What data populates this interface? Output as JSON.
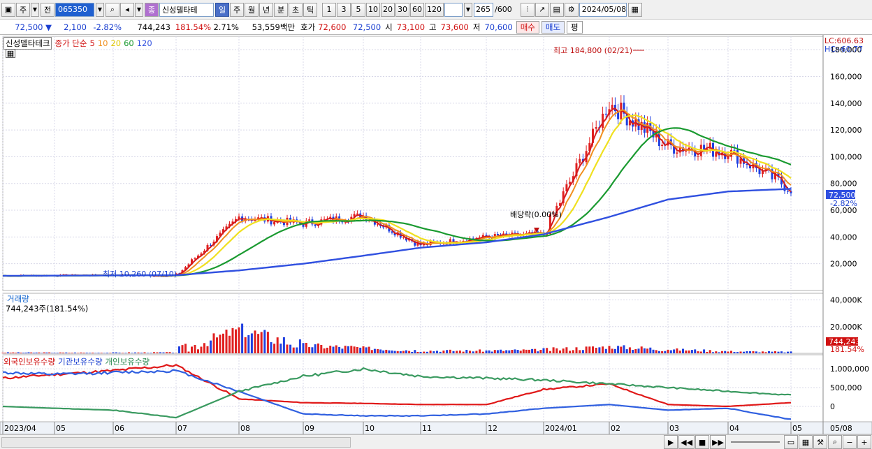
{
  "toolbar": {
    "period_options": [
      "주",
      "전"
    ],
    "code": "065350",
    "stock_name": "신성델타테",
    "intervals": [
      "일",
      "주",
      "월",
      "년",
      "분",
      "초",
      "틱"
    ],
    "active_interval": "일",
    "numbers": [
      "1",
      "3",
      "5",
      "10",
      "20",
      "30",
      "60",
      "120"
    ],
    "count": "265",
    "count_total": "/600",
    "date": "2024/05/08"
  },
  "quote": {
    "price": "72,500",
    "change": "2,100",
    "change_pct": "-2.82%",
    "volume": "744,243",
    "volume_ratio": "181.54%",
    "turnover_pct": "2.71%",
    "amount": "53,559백만",
    "bid_label": "호가",
    "bid": "72,600",
    "ask": "72,500",
    "open_label": "시",
    "open": "73,100",
    "high_label": "고",
    "high": "73,600",
    "low_label": "저",
    "low": "70,600",
    "buy_label": "매수",
    "sell_label": "매도",
    "eval_label": "평"
  },
  "price_panel": {
    "stock_label": "신성델타테크",
    "indicator_label": "종가 단순",
    "ma_labels": [
      "5",
      "10",
      "20",
      "60",
      "120"
    ],
    "lc": "LC:606.63",
    "hc": "HC:-60.77",
    "max_note": "최고 184,800 (02/21)",
    "min_note": "최저 10,260 (07/10)",
    "dividend_note": "배당락(0.00%)",
    "last_price_tag": "72,500",
    "last_pct_tag": "-2.82%",
    "y_ticks": [
      "180,000",
      "160,000",
      "140,000",
      "120,000",
      "100,000",
      "80,000",
      "60,000",
      "40,000",
      "20,000"
    ]
  },
  "volume_panel": {
    "title": "거래량",
    "value_label": "744,243주(181.54%)",
    "tag_value": "744,243",
    "tag_pct": "181.54%",
    "y_ticks": [
      "40,000K",
      "20,000K"
    ]
  },
  "holdings_panel": {
    "series_labels": [
      "외국인보유수량",
      "기관보유수량",
      "개인보유수량"
    ],
    "y_ticks": [
      "1,000,000",
      "500,000",
      "0"
    ]
  },
  "x_axis": [
    "2023/04",
    "05",
    "06",
    "07",
    "08",
    "09",
    "10",
    "11",
    "12",
    "2024/01",
    "02",
    "03",
    "04",
    "05",
    "05/08"
  ],
  "colors": {
    "ma5": "#d41c1c",
    "ma10": "#f09020",
    "ma20": "#f0e020",
    "ma60": "#1a9a30",
    "ma120": "#3050e0",
    "up": "#e02020",
    "down": "#2040e0",
    "foreign": "#e01818",
    "institution": "#3060e0",
    "individual": "#3a9a60"
  },
  "chart_data": {
    "type": "candlestick",
    "x": [
      "2023/04",
      "05",
      "06",
      "07",
      "08",
      "09",
      "10",
      "11",
      "12",
      "2024/01",
      "02",
      "03",
      "04",
      "05"
    ],
    "close": [
      11000,
      11500,
      12000,
      11200,
      52000,
      48000,
      58000,
      36000,
      40000,
      45000,
      135000,
      110000,
      100000,
      72500
    ],
    "ma120": [
      11000,
      11100,
      11300,
      11400,
      15000,
      20000,
      26000,
      32000,
      36000,
      42000,
      55000,
      68000,
      74000,
      76000
    ],
    "ylim": [
      0,
      190000
    ],
    "volume_ylim": [
      0,
      45000
    ],
    "holdings": [
      {
        "name": "외국인보유수량",
        "values": [
          750000,
          850000,
          950000,
          1100000,
          200000,
          100000,
          80000,
          50000,
          50000,
          450000,
          600000,
          50000,
          0,
          100000
        ]
      },
      {
        "name": "기관보유수량",
        "values": [
          900000,
          850000,
          900000,
          950000,
          400000,
          -200000,
          -250000,
          -250000,
          -200000,
          -50000,
          50000,
          -100000,
          -50000,
          -350000
        ]
      },
      {
        "name": "개인보유수량",
        "values": [
          0,
          -50000,
          -100000,
          -300000,
          400000,
          800000,
          1000000,
          800000,
          750000,
          700000,
          600000,
          500000,
          400000,
          300000
        ]
      }
    ]
  }
}
